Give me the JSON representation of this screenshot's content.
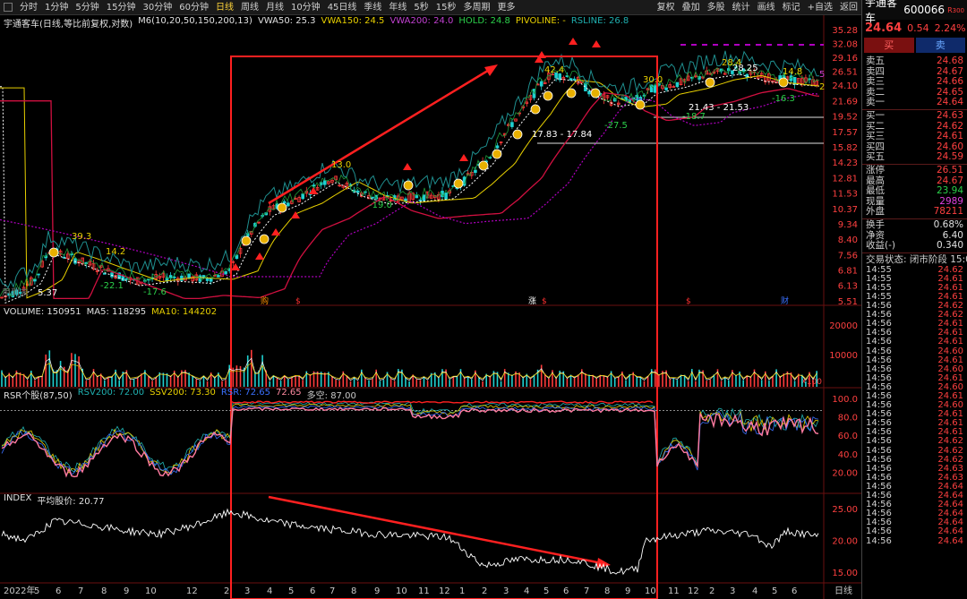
{
  "toolbar": {
    "periods": [
      "分时",
      "1分钟",
      "5分钟",
      "15分钟",
      "30分钟",
      "60分钟",
      "日线",
      "周线",
      "月线",
      "10分钟",
      "45日线",
      "季线",
      "年线",
      "5秒",
      "15秒",
      "多周期",
      "更多"
    ],
    "active_period": "日线",
    "tools": [
      "复权",
      "叠加",
      "多股",
      "统计",
      "画线",
      "标记",
      "+自选",
      "返回"
    ]
  },
  "main_legend": {
    "title": "宇通客车(日线,等比前复权,对数)",
    "m6": "M6(10,20,50,150,200,13)",
    "vwa50": "VWA50: 25.3",
    "vwa150": "VWA150: 24.5",
    "vwa200": "VWA200: 24.0",
    "hold": "HOLD: 24.8",
    "pivoline": "PIVOLINE: -",
    "rsline": "RSLINE: 26.8"
  },
  "volume_legend": {
    "title": "VOLUME: 150951",
    "ma5": "MA5: 118295",
    "ma10": "MA10: 144202",
    "unit": "X100"
  },
  "rsr_legend": {
    "title": "RSR个股(87,50)",
    "rsv200": "RSV200: 72.00",
    "ssv200": "SSV200: 73.30",
    "rsr": "RSR: 72.65",
    "rsr_value": "72.65",
    "duokong": "多空: 87.00"
  },
  "index_legend": {
    "title": "INDEX",
    "avg": "平均股价: 20.77"
  },
  "price_axis": [
    "35.28",
    "32.08",
    "29.16",
    "26.51",
    "24.10",
    "21.69",
    "19.52",
    "17.57",
    "15.82",
    "14.23",
    "12.81",
    "11.53",
    "10.37",
    "9.34",
    "8.40",
    "7.56",
    "6.81",
    "6.13",
    "5.51"
  ],
  "volume_axis": [
    "20000",
    "10000"
  ],
  "rsr_axis": [
    "100.0",
    "80.0",
    "60.0",
    "40.0",
    "20.00"
  ],
  "index_axis": [
    "25.00",
    "20.00",
    "15.00"
  ],
  "x_axis": [
    "2022年",
    "5",
    "6",
    "7",
    "8",
    "9",
    "10",
    "12",
    "2",
    "3",
    "4",
    "5",
    "6",
    "7",
    "8",
    "9",
    "10",
    "11",
    "12",
    "1",
    "2",
    "3",
    "4",
    "5",
    "6",
    "7",
    "8",
    "9",
    "10",
    "11",
    "12",
    "2",
    "3",
    "4",
    "5",
    "6"
  ],
  "x_axis_unit": "日线",
  "annotations": {
    "low_left": "5.37",
    "low_left_prefix": "用到未",
    "p39_3": "39.3",
    "p14_2": "14.2",
    "n22_1": "-22.1",
    "n17_6": "-17.6",
    "p13_0": "13.0",
    "n19_0": "-19.0",
    "range_low": "17.83 - 17.84",
    "n27_5": "-27.5",
    "p42_4": "42.4",
    "range_right": "21.43 - 21.53",
    "n18_7": "-18.7",
    "p28_25": "28.25",
    "p28_4": "28.4",
    "p14_8": "14.8",
    "n16_3": "-16.3",
    "p30_0": "30.0",
    "right_mark_5": "5",
    "right_mark_2": "2",
    "event_1": "购",
    "event_2": "涨",
    "event_3": "财",
    "event_s": "$"
  },
  "chart_data": {
    "type": "line",
    "title": "宇通客车(日线,等比前复权,对数)",
    "series": [
      {
        "name": "close",
        "x": [
          "2022-04",
          "2022-06",
          "2022-08",
          "2022-10",
          "2022-12",
          "2023-02",
          "2023-03",
          "2023-05",
          "2023-07",
          "2023-09",
          "2023-11",
          "2024-01",
          "2024-03",
          "2024-05",
          "2024-07",
          "2024-09",
          "2024-11",
          "2025-01",
          "2025-03",
          "2025-05"
        ],
        "values": [
          5.4,
          7.2,
          6.5,
          6.2,
          6.4,
          6.8,
          8.5,
          11.0,
          13.0,
          11.0,
          11.5,
          13.5,
          22.0,
          27.5,
          22.0,
          20.5,
          24.5,
          25.5,
          27.0,
          24.6
        ]
      }
    ],
    "ylim": [
      5.51,
      35.28
    ],
    "log_scale": true
  },
  "right_panel": {
    "name": "宇通客车",
    "code": "600066",
    "r_badge": "R",
    "r_sub": "300",
    "price": "24.64",
    "change": "0.54",
    "change_pct": "2.24%",
    "buy_label": "买",
    "sell_label": "卖",
    "asks": [
      {
        "label": "卖五",
        "value": "24.68"
      },
      {
        "label": "卖四",
        "value": "24.67"
      },
      {
        "label": "卖三",
        "value": "24.66"
      },
      {
        "label": "卖二",
        "value": "24.65"
      },
      {
        "label": "卖一",
        "value": "24.64"
      }
    ],
    "bids": [
      {
        "label": "买一",
        "value": "24.63"
      },
      {
        "label": "买二",
        "value": "24.62"
      },
      {
        "label": "买三",
        "value": "24.61"
      },
      {
        "label": "买四",
        "value": "24.60"
      },
      {
        "label": "买五",
        "value": "24.59"
      }
    ],
    "stats": [
      {
        "label": "涨停",
        "value": "26.51",
        "cls": "up"
      },
      {
        "label": "最高",
        "value": "24.67",
        "cls": "up"
      },
      {
        "label": "最低",
        "value": "23.94",
        "cls": "down"
      },
      {
        "label": "现量",
        "value": "2989",
        "cls": "pink"
      },
      {
        "label": "外盘",
        "value": "78211",
        "cls": "up"
      }
    ],
    "stats2": [
      {
        "label": "换手",
        "value": "0.68%",
        "cls": "white"
      },
      {
        "label": "净资",
        "value": "6.40",
        "cls": "white"
      },
      {
        "label": "收益(-)",
        "value": "0.340",
        "cls": "white"
      }
    ],
    "state": "交易状态: 闭市阶段 15:00",
    "ticks": [
      {
        "t": "14:55",
        "p": "24.62"
      },
      {
        "t": "14:55",
        "p": "24.61"
      },
      {
        "t": "14:55",
        "p": "24.61"
      },
      {
        "t": "14:55",
        "p": "24.61"
      },
      {
        "t": "14:56",
        "p": "24.62"
      },
      {
        "t": "14:56",
        "p": "24.62"
      },
      {
        "t": "14:56",
        "p": "24.61"
      },
      {
        "t": "14:56",
        "p": "24.61"
      },
      {
        "t": "14:56",
        "p": "24.61"
      },
      {
        "t": "14:56",
        "p": "24.60"
      },
      {
        "t": "14:56",
        "p": "24.61"
      },
      {
        "t": "14:56",
        "p": "24.60"
      },
      {
        "t": "14:56",
        "p": "24.61"
      },
      {
        "t": "14:56",
        "p": "24.60"
      },
      {
        "t": "14:56",
        "p": "24.61"
      },
      {
        "t": "14:56",
        "p": "24.60"
      },
      {
        "t": "14:56",
        "p": "24.61"
      },
      {
        "t": "14:56",
        "p": "24.61"
      },
      {
        "t": "14:56",
        "p": "24.61"
      },
      {
        "t": "14:56",
        "p": "24.62"
      },
      {
        "t": "14:56",
        "p": "24.62"
      },
      {
        "t": "14:56",
        "p": "24.62"
      },
      {
        "t": "14:56",
        "p": "24.63"
      },
      {
        "t": "14:56",
        "p": "24.63"
      },
      {
        "t": "14:56",
        "p": "24.64"
      },
      {
        "t": "14:56",
        "p": "24.64"
      },
      {
        "t": "14:56",
        "p": "24.64"
      },
      {
        "t": "14:56",
        "p": "24.64"
      },
      {
        "t": "14:56",
        "p": "24.64"
      },
      {
        "t": "14:56",
        "p": "24.64"
      },
      {
        "t": "14:56",
        "p": "24.64"
      }
    ]
  },
  "colors": {
    "up": "#ff3a3a",
    "down": "#1fd0d0",
    "ma_white": "#ffffff",
    "ma_yellow": "#e8d000",
    "ma_purple": "#b000c0",
    "ma_red": "#d01040",
    "rsline": "#1f8f8f",
    "highlight_box": "#ff2020"
  }
}
